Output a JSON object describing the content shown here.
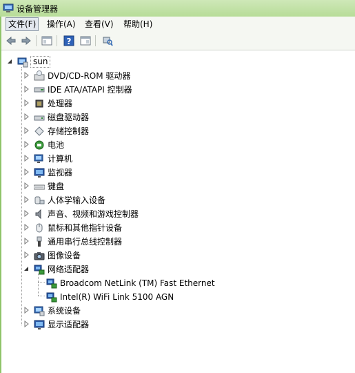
{
  "window": {
    "title": "设备管理器"
  },
  "menu": [
    "文件(F)",
    "操作(A)",
    "查看(V)",
    "帮助(H)"
  ],
  "toolbar": [
    {
      "name": "back-icon"
    },
    {
      "name": "forward-icon"
    },
    {
      "name": "properties-panel-icon"
    },
    {
      "name": "help-icon"
    },
    {
      "name": "view-panel-icon"
    },
    {
      "name": "scan-hardware-icon"
    }
  ],
  "tree": {
    "root": {
      "label": "sun",
      "icon": "computer-icon"
    },
    "categories": [
      {
        "label": "DVD/CD-ROM 驱动器",
        "icon": "dvd-drive-icon",
        "expanded": false
      },
      {
        "label": "IDE ATA/ATAPI 控制器",
        "icon": "ide-controller-icon",
        "expanded": false
      },
      {
        "label": "处理器",
        "icon": "processor-icon",
        "expanded": false
      },
      {
        "label": "磁盘驱动器",
        "icon": "disk-drive-icon",
        "expanded": false
      },
      {
        "label": "存储控制器",
        "icon": "storage-controller-icon",
        "expanded": false
      },
      {
        "label": "电池",
        "icon": "battery-icon",
        "expanded": false
      },
      {
        "label": "计算机",
        "icon": "computer-icon",
        "expanded": false
      },
      {
        "label": "监视器",
        "icon": "monitor-icon",
        "expanded": false
      },
      {
        "label": "键盘",
        "icon": "keyboard-icon",
        "expanded": false
      },
      {
        "label": "人体学输入设备",
        "icon": "hid-icon",
        "expanded": false
      },
      {
        "label": "声音、视频和游戏控制器",
        "icon": "speaker-icon",
        "expanded": false
      },
      {
        "label": "鼠标和其他指针设备",
        "icon": "mouse-icon",
        "expanded": false
      },
      {
        "label": "通用串行总线控制器",
        "icon": "usb-icon",
        "expanded": false
      },
      {
        "label": "图像设备",
        "icon": "camera-icon",
        "expanded": false
      },
      {
        "label": "网络适配器",
        "icon": "network-adapter-icon",
        "expanded": true,
        "children": [
          {
            "label": "Broadcom NetLink (TM) Fast Ethernet",
            "icon": "network-adapter-icon"
          },
          {
            "label": "Intel(R) WiFi Link 5100 AGN",
            "icon": "network-adapter-icon"
          }
        ]
      },
      {
        "label": "系统设备",
        "icon": "system-device-icon",
        "expanded": false
      },
      {
        "label": "显示适配器",
        "icon": "display-adapter-icon",
        "expanded": false
      }
    ]
  }
}
